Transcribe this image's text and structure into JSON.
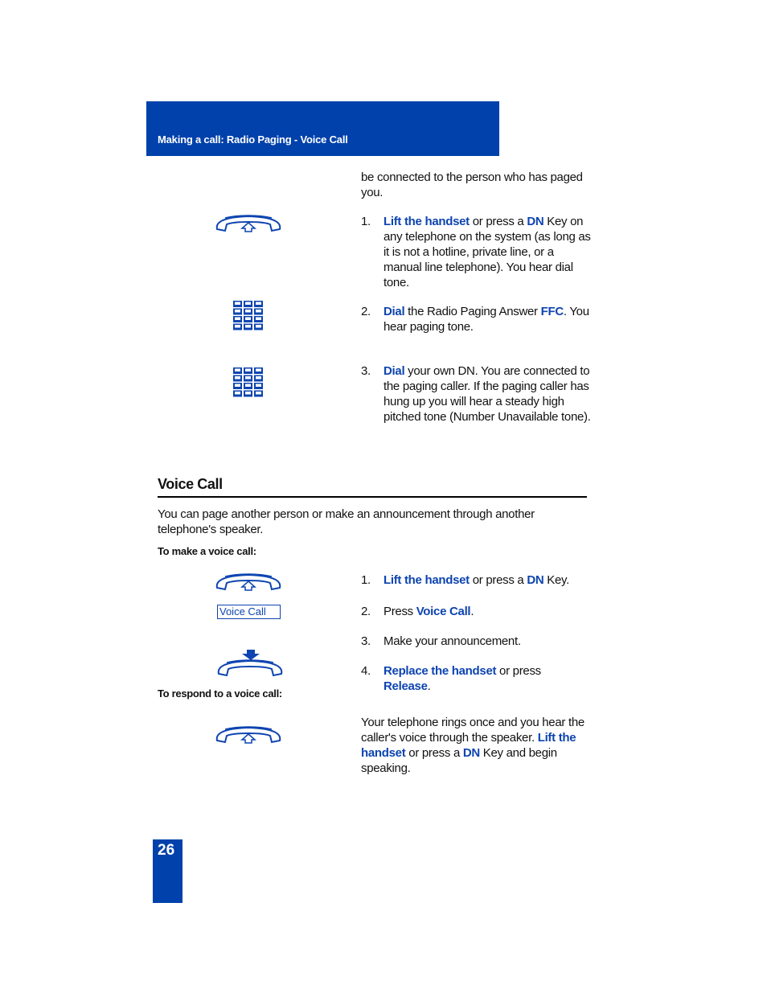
{
  "header": {
    "title": "Making a call: Radio Paging - Voice Call",
    "color": "#0041ab"
  },
  "intro_continuation": "be connected to the person who has paged you.",
  "radio_paging_steps": [
    {
      "number": "1.",
      "icon": "handset-lift-icon",
      "parts": [
        {
          "text": "Lift the handset",
          "highlight": true
        },
        {
          "text": " or press a ",
          "highlight": false
        },
        {
          "text": "DN",
          "highlight": true
        },
        {
          "text": " Key on any telephone on the system (as long as it is not a hotline, private line, or a manual line telephone). You hear dial tone.",
          "highlight": false
        }
      ]
    },
    {
      "number": "2.",
      "icon": "dialpad-icon",
      "parts": [
        {
          "text": "Dial",
          "highlight": true
        },
        {
          "text": " the Radio Paging Answer ",
          "highlight": false
        },
        {
          "text": "FFC",
          "highlight": true
        },
        {
          "text": ". You hear paging tone.",
          "highlight": false
        }
      ]
    },
    {
      "number": "3.",
      "icon": "dialpad-icon",
      "parts": [
        {
          "text": "Dial",
          "highlight": true
        },
        {
          "text": " your own DN. You are connected to the paging caller. If the paging caller has hung up you will hear a steady high pitched tone (Number Unavailable tone).",
          "highlight": false
        }
      ]
    }
  ],
  "voice_call": {
    "title": "Voice Call",
    "description": "You can page another person or make an announcement through another telephone's speaker.",
    "make_heading": "To make a voice call:",
    "softkey_label": "Voice Call",
    "make_steps": [
      {
        "number": "1.",
        "parts": [
          {
            "text": "Lift the handset",
            "highlight": true
          },
          {
            "text": " or press a ",
            "highlight": false
          },
          {
            "text": "DN",
            "highlight": true
          },
          {
            "text": " Key.",
            "highlight": false
          }
        ]
      },
      {
        "number": "2.",
        "parts": [
          {
            "text": "Press ",
            "highlight": false
          },
          {
            "text": "Voice Call",
            "highlight": true
          },
          {
            "text": ".",
            "highlight": false
          }
        ]
      },
      {
        "number": "3.",
        "parts": [
          {
            "text": "Make your announcement.",
            "highlight": false
          }
        ]
      },
      {
        "number": "4.",
        "parts": [
          {
            "text": "Replace the handset",
            "highlight": true
          },
          {
            "text": " or press ",
            "highlight": false
          },
          {
            "text": "Release",
            "highlight": true
          },
          {
            "text": ".",
            "highlight": false
          }
        ]
      }
    ],
    "respond_heading": "To respond to a voice call:",
    "respond_parts": [
      {
        "text": "Your telephone rings once and you hear the caller's voice through the speaker. ",
        "highlight": false
      },
      {
        "text": "Lift the handset",
        "highlight": true
      },
      {
        "text": " or press a ",
        "highlight": false
      },
      {
        "text": "DN",
        "highlight": true
      },
      {
        "text": " Key and begin speaking.",
        "highlight": false
      }
    ]
  },
  "page_number": "26",
  "colors": {
    "brand_blue": "#0041ab",
    "highlight_blue": "#0d44b0"
  }
}
